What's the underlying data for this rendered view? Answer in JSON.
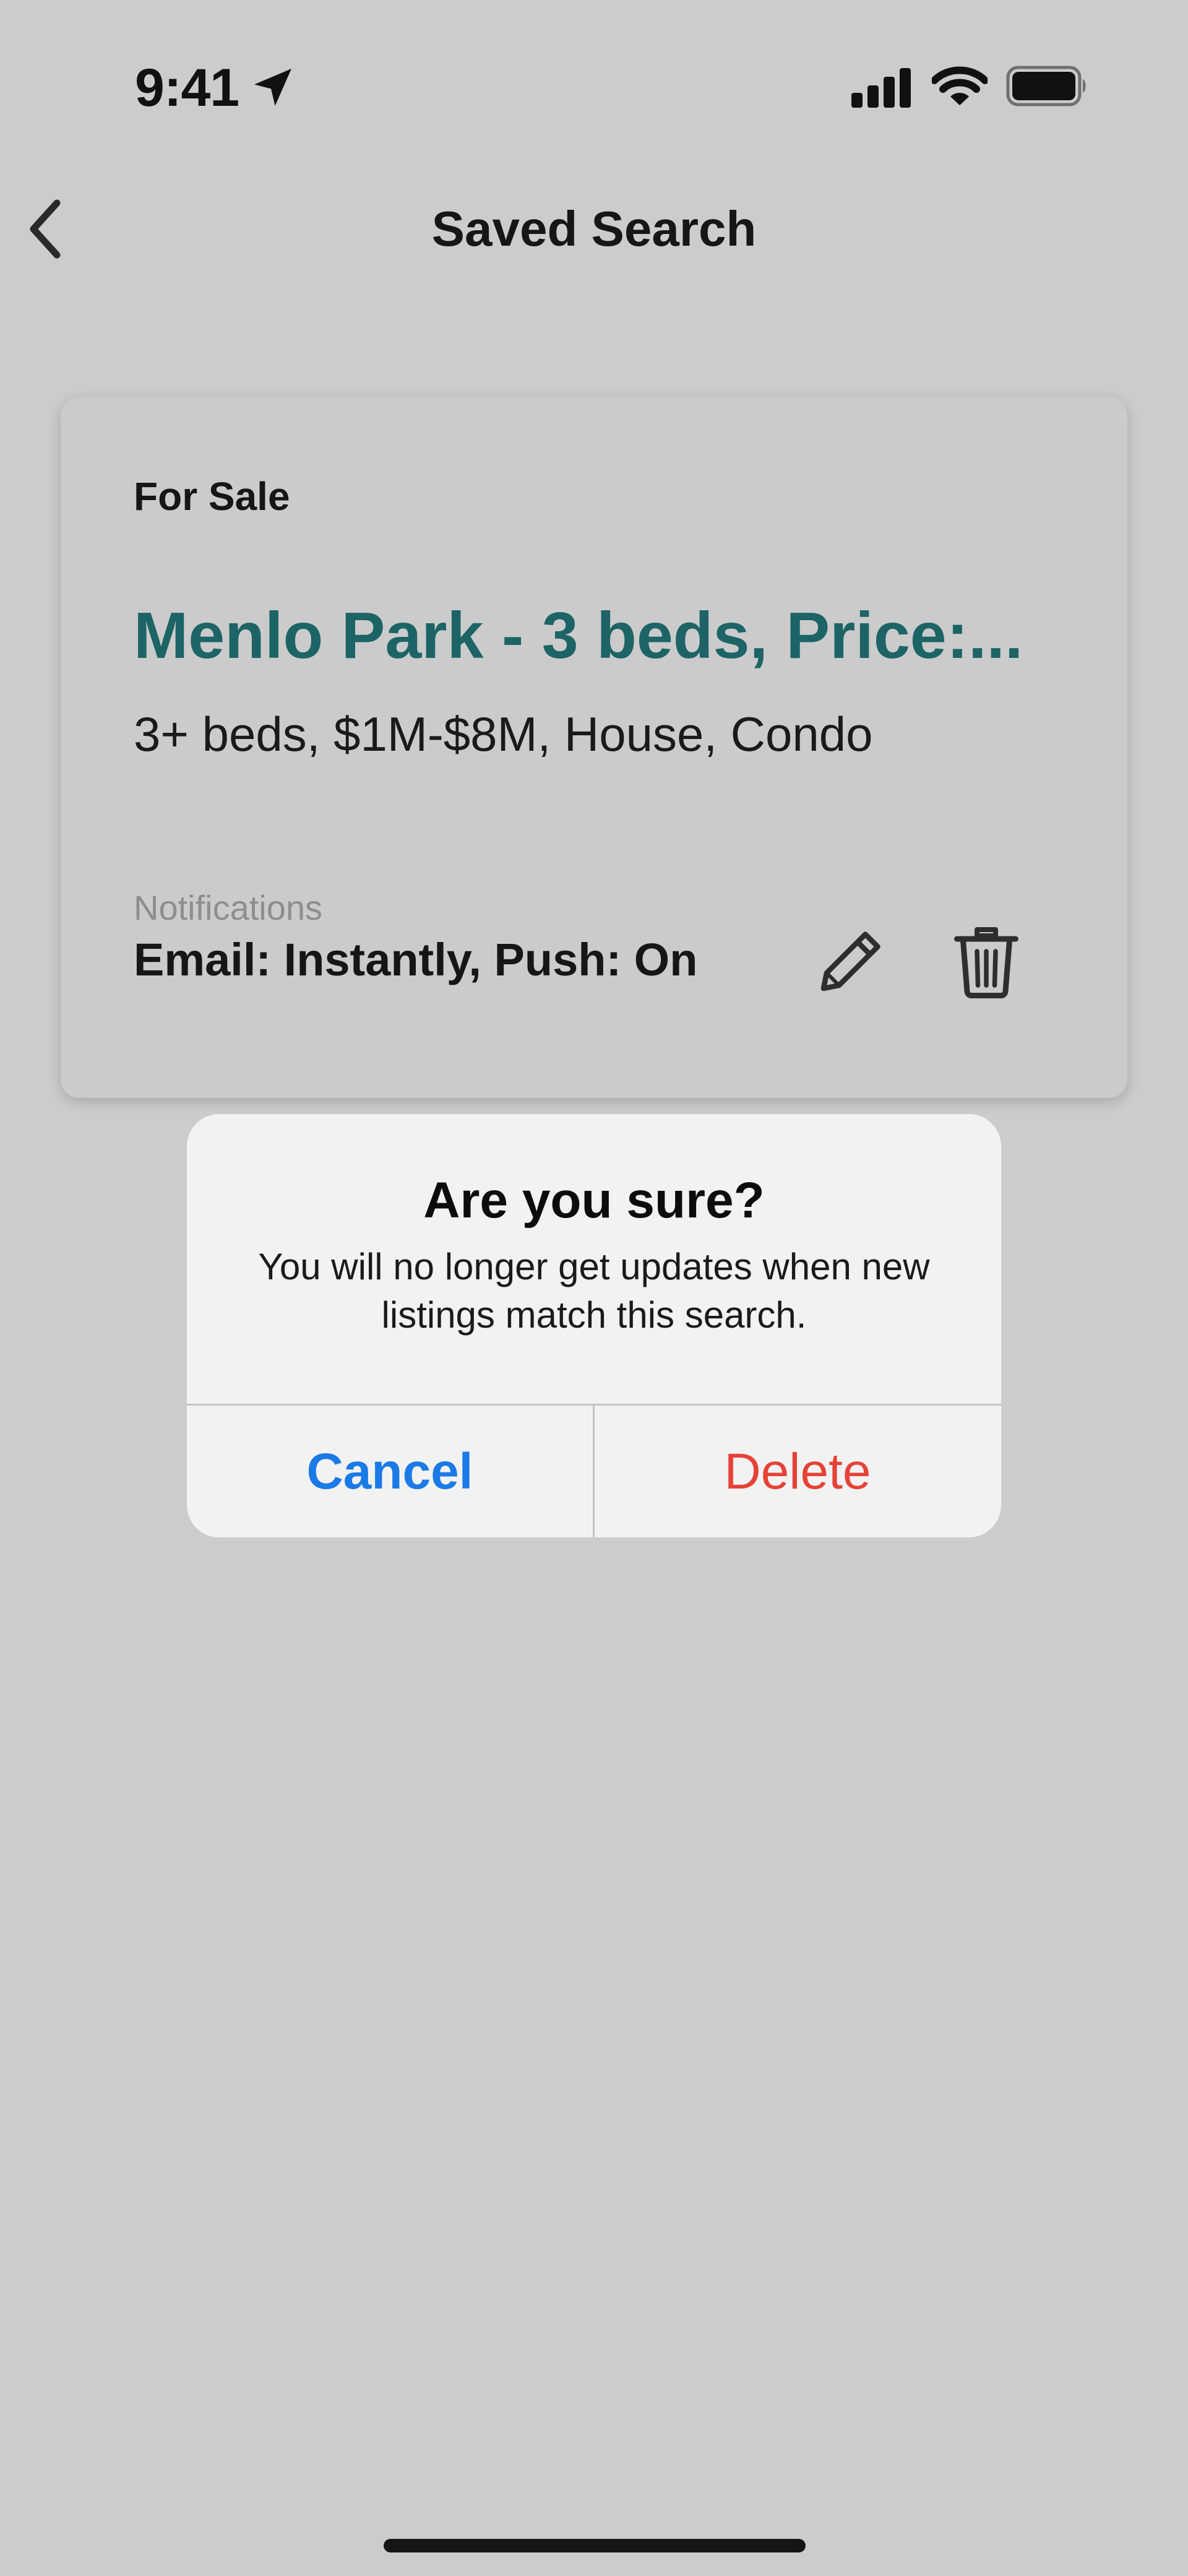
{
  "status_bar": {
    "time": "9:41",
    "icons": [
      "location-arrow-icon",
      "cellular-signal-icon",
      "wifi-icon",
      "battery-icon"
    ]
  },
  "nav": {
    "back_icon": "chevron-left-icon",
    "title": "Saved Search"
  },
  "saved_search": {
    "listing_type": "For Sale",
    "title": "Menlo Park - 3  beds, Price:...",
    "criteria": "3+ beds, $1M-$8M, House, Condo",
    "notifications_label": "Notifications",
    "notifications_value": "Email: Instantly, Push: On",
    "edit_icon": "pencil-icon",
    "delete_icon": "trash-icon"
  },
  "alert": {
    "title": "Are you sure?",
    "message": "You will no longer get updates when new listings match this search.",
    "cancel_label": "Cancel",
    "delete_label": "Delete"
  },
  "colors": {
    "background": "#cccccc",
    "title_teal": "#1d6466",
    "ios_blue": "#1a7ae6",
    "destructive_red": "#e64236",
    "alert_background": "#f2f2f2"
  }
}
